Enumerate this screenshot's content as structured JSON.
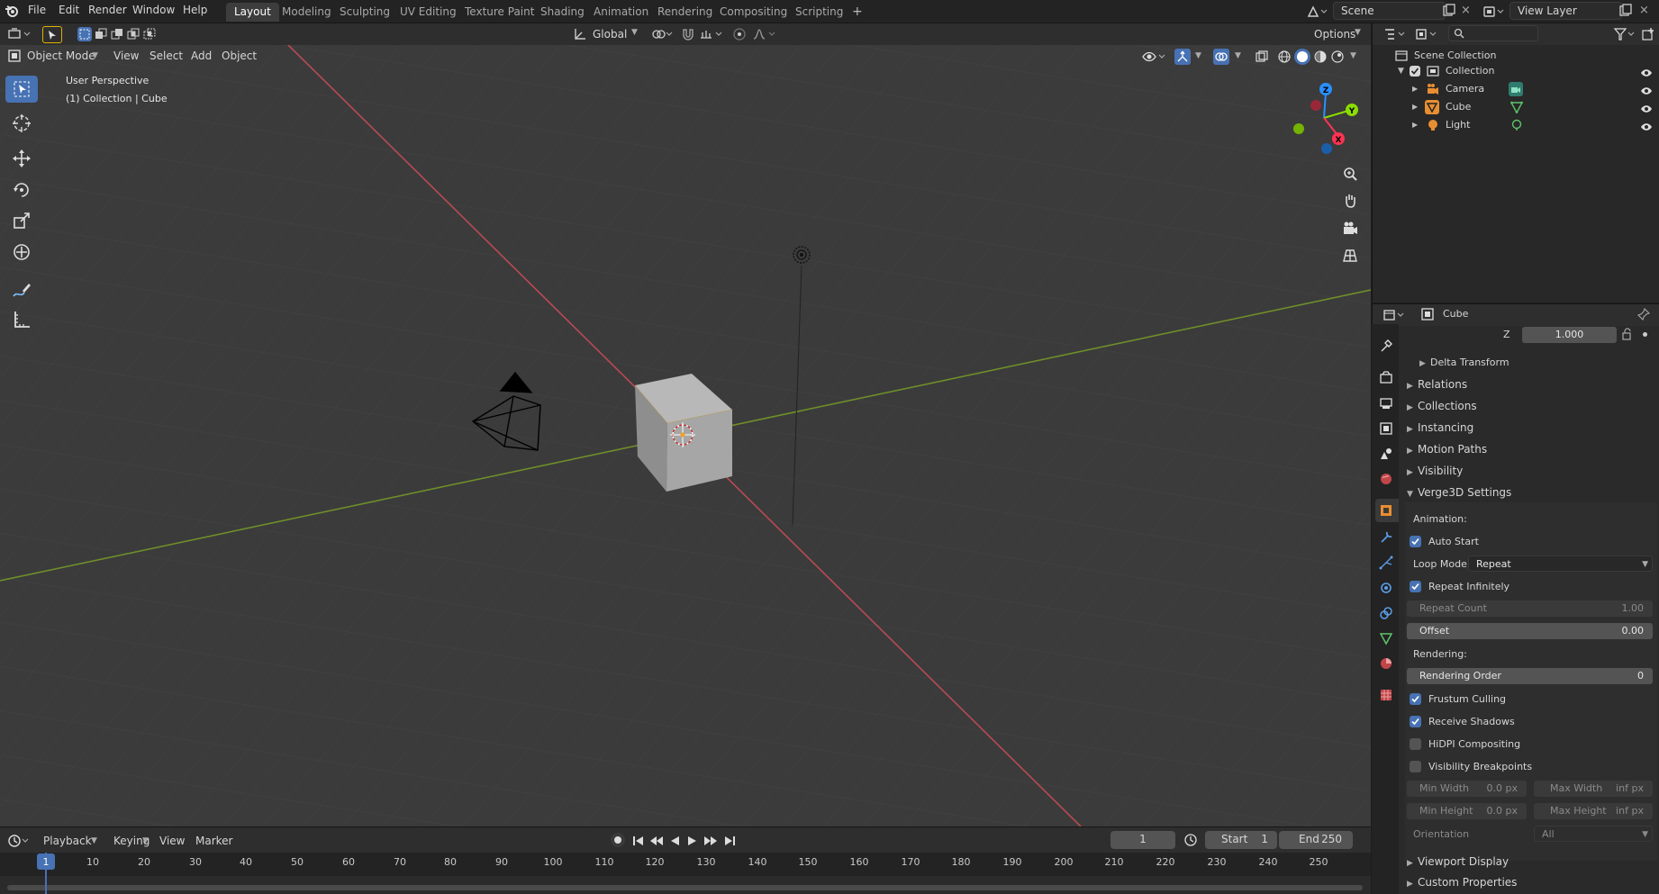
{
  "topbar": {
    "menus": [
      "File",
      "Edit",
      "Render",
      "Window",
      "Help"
    ],
    "workspaces": [
      "Layout",
      "Modeling",
      "Sculpting",
      "UV Editing",
      "Texture Paint",
      "Shading",
      "Animation",
      "Rendering",
      "Compositing",
      "Scripting"
    ],
    "active_workspace": "Layout",
    "add_tab": "+",
    "scene": "Scene",
    "view_layer": "View Layer"
  },
  "viewport_header": {
    "transform_orientation": "Global",
    "options": "Options"
  },
  "viewport_subheader": {
    "mode": "Object Mode",
    "menus": [
      "View",
      "Select",
      "Add",
      "Object"
    ]
  },
  "viewport": {
    "perspective": "User Perspective",
    "context": "(1) Collection | Cube",
    "gizmo": {
      "z": "Z",
      "y": "Y",
      "x": "X"
    }
  },
  "outliner": {
    "root": "Scene Collection",
    "collection": "Collection",
    "items": [
      "Camera",
      "Cube",
      "Light"
    ]
  },
  "properties": {
    "object_name": "Cube",
    "z_label": "Z",
    "z_value": "1.000",
    "delta_transform": "Delta Transform",
    "sections": [
      "Relations",
      "Collections",
      "Instancing",
      "Motion Paths",
      "Visibility",
      "Verge3D Settings"
    ],
    "animation_label": "Animation:",
    "auto_start": "Auto Start",
    "loop_mode_label": "Loop Mode:",
    "loop_mode": "Repeat",
    "repeat_infinitely": "Repeat Infinitely",
    "repeat_count_label": "Repeat Count",
    "repeat_count": "1.00",
    "offset_label": "Offset",
    "offset": "0.00",
    "rendering_label": "Rendering:",
    "rendering_order_label": "Rendering Order",
    "rendering_order": "0",
    "frustum_culling": "Frustum Culling",
    "receive_shadows": "Receive Shadows",
    "hidpi": "HiDPI Compositing",
    "vis_breakpoints": "Visibility Breakpoints",
    "min_width_label": "Min Width",
    "min_width": "0.0 px",
    "max_width_label": "Max Width",
    "max_width": "inf px",
    "min_height_label": "Min Height",
    "min_height": "0.0 px",
    "max_height_label": "Max Height",
    "max_height": "inf px",
    "orientation_label": "Orientation",
    "orientation": "All",
    "viewport_display": "Viewport Display",
    "custom_properties": "Custom Properties"
  },
  "timeline": {
    "menus": [
      "Playback",
      "Keying",
      "View",
      "Marker"
    ],
    "current_frame": "1",
    "start_label": "Start",
    "start": "1",
    "end_label": "End",
    "end": "250",
    "ticks": [
      "1",
      "10",
      "20",
      "30",
      "40",
      "50",
      "60",
      "70",
      "80",
      "90",
      "100",
      "110",
      "120",
      "130",
      "140",
      "150",
      "160",
      "170",
      "180",
      "190",
      "200",
      "210",
      "220",
      "230",
      "240",
      "250"
    ]
  },
  "colors": {
    "accent": "#4772b3",
    "x_axis": "#ff3352",
    "y_axis": "#8bdc00",
    "z_axis": "#2890ff"
  }
}
